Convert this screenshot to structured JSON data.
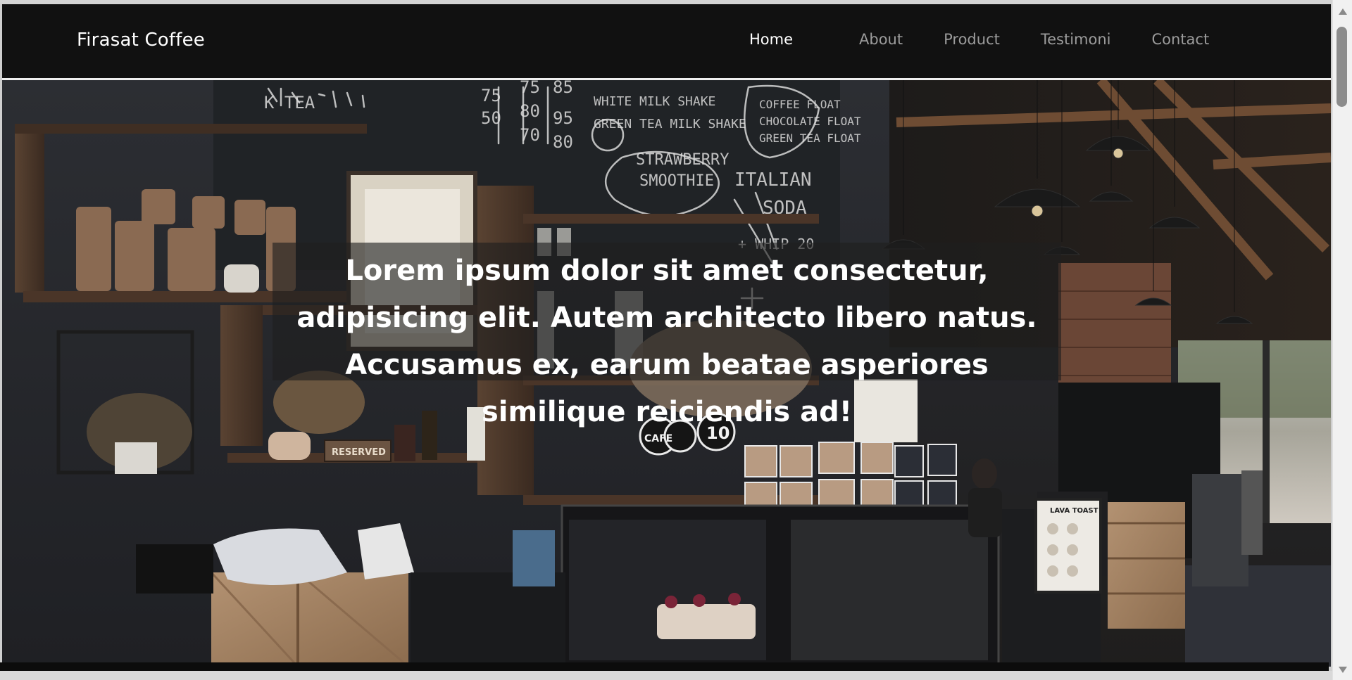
{
  "navbar": {
    "brand": "Firasat Coffee",
    "links": [
      {
        "label": "Home",
        "active": true
      },
      {
        "label": "About",
        "active": false
      },
      {
        "label": "Product",
        "active": false
      },
      {
        "label": "Testimoni",
        "active": false
      },
      {
        "label": "Contact",
        "active": false
      }
    ]
  },
  "hero": {
    "image": "cafe-interior-photo",
    "caption": "Lorem ipsum dolor sit amet consectetur, adipisicing elit. Autem architecto libero natus. Accusamus ex, earum beatae asperiores similique reiciendis ad!",
    "chalkboard": {
      "line1": "MILK TEA",
      "menu_lines": [
        "WHITE MILK SHAKE",
        "GREEN TEA MILK SHAKE",
        "STRAWBERRY SMOOTHIE",
        "COFFEE FLOAT",
        "CHOCOLATE FLOAT",
        "GREEN TEA FLOAT",
        "ITALIAN SODA",
        "+ WHIP 20"
      ],
      "prices": [
        "75",
        "75",
        "85",
        "50",
        "80",
        "95",
        "70",
        "80"
      ]
    },
    "signs": {
      "reserved": "RESERVED",
      "cafe": "CAFE",
      "number": "10",
      "lava_toast": "LAVA TOAST"
    }
  },
  "colors": {
    "navbar_bg": "#111111",
    "nav_active": "#ffffff",
    "nav_inactive": "#9c9c9c",
    "caption_overlay": "rgba(30,30,30,0.62)"
  },
  "scrollbar": {
    "visible": true
  }
}
